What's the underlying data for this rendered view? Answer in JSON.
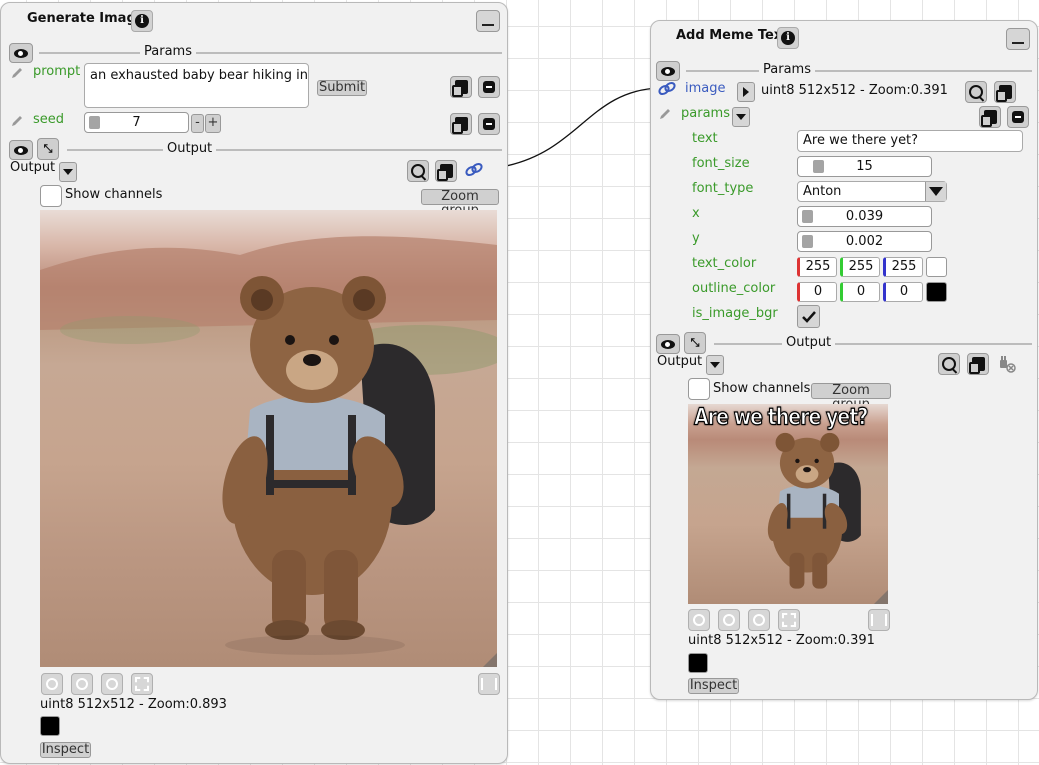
{
  "node1": {
    "title": "Generate Image",
    "info_icon": "info-icon",
    "params_label": "Params",
    "prompt_label": "prompt",
    "prompt_value": "an exhausted baby bear hiking in the",
    "submit_label": "Submit",
    "seed_label": "seed",
    "seed_value": "7",
    "seed_minus": "-",
    "seed_plus": "+",
    "output_label": "Output",
    "output_dropdown_label": "Output",
    "show_channels": "Show channels",
    "zoom_group": "Zoom group",
    "image_info": "uint8 512x512 - Zoom:0.893",
    "inspect": "Inspect"
  },
  "node2": {
    "title": "Add Meme Text",
    "params_label": "Params",
    "image_label": "image",
    "image_info": "uint8 512x512 - Zoom:0.391",
    "params_label2": "params",
    "fields": {
      "text_label": "text",
      "text_value": "Are we there yet?",
      "font_size_label": "font_size",
      "font_size_value": "15",
      "font_type_label": "font_type",
      "font_type_value": "Anton",
      "x_label": "x",
      "x_value": "0.039",
      "y_label": "y",
      "y_value": "0.002",
      "text_color_label": "text_color",
      "text_color_r": "255",
      "text_color_g": "255",
      "text_color_b": "255",
      "outline_color_label": "outline_color",
      "outline_color_r": "0",
      "outline_color_g": "0",
      "outline_color_b": "0",
      "is_image_bgr_label": "is_image_bgr"
    },
    "output_label": "Output",
    "output_dropdown_label": "Output",
    "show_channels": "Show channels",
    "zoom_group": "Zoom group",
    "meme_text": "Are we there yet?",
    "inspect": "Inspect"
  },
  "colors": {
    "label_green": "#3a9a2a",
    "link_blue": "#3a5bbf",
    "swatch_text": "#ffffff",
    "swatch_outline": "#000000"
  }
}
